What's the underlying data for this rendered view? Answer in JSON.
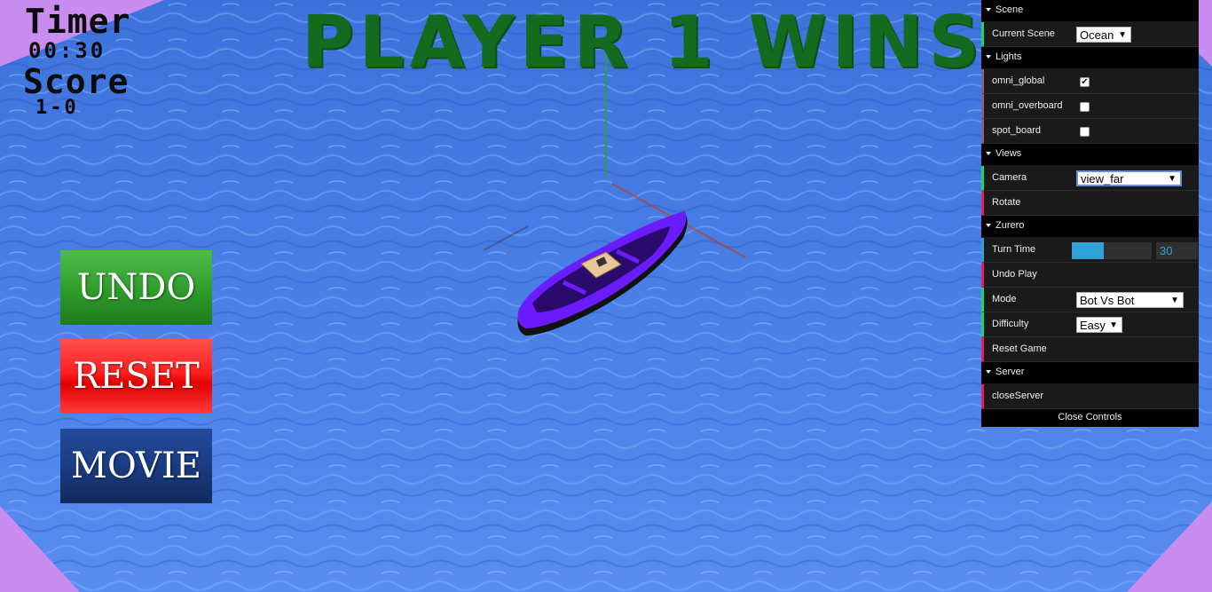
{
  "hud": {
    "timer_label": "Timer",
    "timer_value": "00:30",
    "score_label": "Score",
    "score_value": "1-0",
    "winner_banner": "PLAYER 1 WINS"
  },
  "buttons": {
    "undo": "UNDO",
    "reset": "RESET",
    "movie": "MOVIE"
  },
  "gui": {
    "scene": {
      "title": "Scene",
      "current_scene_label": "Current Scene",
      "current_scene_value": "Ocean"
    },
    "lights": {
      "title": "Lights",
      "items": [
        {
          "label": "omni_global",
          "checked": true
        },
        {
          "label": "omni_overboard",
          "checked": false
        },
        {
          "label": "spot_board",
          "checked": false
        }
      ]
    },
    "views": {
      "title": "Views",
      "camera_label": "Camera",
      "camera_value": "view_far",
      "rotate_label": "Rotate"
    },
    "zurero": {
      "title": "Zurero",
      "turn_time_label": "Turn Time",
      "turn_time_value": "30",
      "turn_time_fraction": 0.4,
      "undo_play_label": "Undo Play",
      "mode_label": "Mode",
      "mode_value": "Bot Vs Bot",
      "difficulty_label": "Difficulty",
      "difficulty_value": "Easy",
      "reset_game_label": "Reset Game"
    },
    "server": {
      "title": "Server",
      "close_server_label": "closeServer"
    },
    "close_controls": "Close Controls"
  },
  "colors": {
    "water": "#3a6fd8",
    "corner": "#c98cf0",
    "boat_hull": "#6a1bff",
    "banner_text": "#136b1f"
  }
}
